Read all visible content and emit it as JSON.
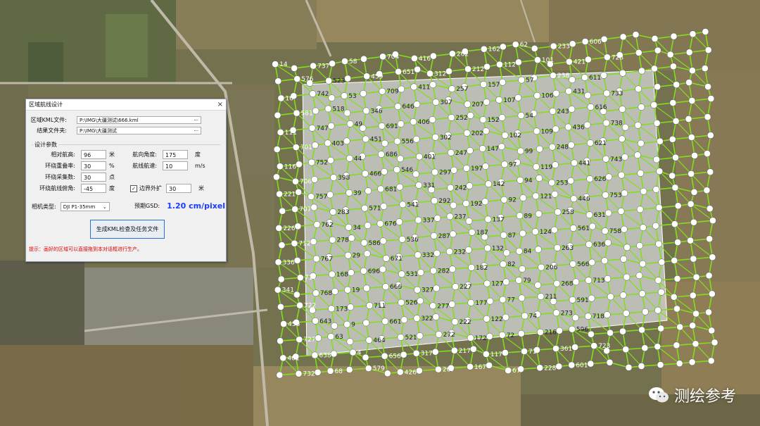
{
  "dialog": {
    "title": "区域航线设计",
    "kml_label": "区域KML文件:",
    "kml_value": "P:\\IMG\\大疆测试\\666.kml",
    "result_label": "结果文件夹:",
    "result_value": "P:\\IMG\\大疆测试",
    "browse": "···",
    "close": "×",
    "params_title": "设计参数",
    "params": {
      "altitude_label": "相对航高:",
      "altitude_value": "96",
      "altitude_unit": "米",
      "heading_label": "航向角度:",
      "heading_value": "175",
      "heading_unit": "度",
      "overlap_label": "环绕重叠率:",
      "overlap_value": "30",
      "overlap_unit": "%",
      "speed_label": "航线航速:",
      "speed_value": "10",
      "speed_unit": "m/s",
      "samples_label": "环绕采集数:",
      "samples_value": "30",
      "samples_unit": "点",
      "pitch_label": "环绕航线俯角:",
      "pitch_value": "-45",
      "pitch_unit": "度",
      "expand_label": "边界外扩",
      "expand_value": "30",
      "expand_unit": "米"
    },
    "camera_label": "相机类型:",
    "camera_value": "DJI P1-35mm",
    "gsd_label": "预期GSD:",
    "gsd_value": "1.20 cm/pixel",
    "generate_button": "生成KML检查及任务文件",
    "tip": "提示：画好的区域可以直接拖到本对话框进行生产。"
  },
  "watermark": "测绘参考",
  "colors": {
    "flight_line": "#7fe01a",
    "waypoint": "#ffffff",
    "gsd": "#1a3cff",
    "tip": "#e00000"
  },
  "map_labels": [
    "14",
    "16",
    "111",
    "116",
    "221",
    "226",
    "336",
    "341",
    "456",
    "461",
    "576",
    "581",
    "701",
    "706",
    "707",
    "712",
    "717",
    "722",
    "727",
    "732",
    "737",
    "742",
    "747",
    "752",
    "757",
    "762",
    "767",
    "768",
    "643",
    "638",
    "523",
    "518",
    "403",
    "398",
    "283",
    "278",
    "168",
    "173",
    "63",
    "68",
    "58",
    "53",
    "49",
    "44",
    "39",
    "34",
    "29",
    "19",
    "9",
    "4",
    "459",
    "346",
    "451",
    "466",
    "571",
    "586",
    "696",
    "711",
    "464",
    "579",
    "704",
    "709",
    "691",
    "686",
    "681",
    "676",
    "671",
    "666",
    "661",
    "656",
    "651",
    "646",
    "556",
    "546",
    "541",
    "536",
    "531",
    "526",
    "521",
    "426",
    "416",
    "411",
    "406",
    "401",
    "331",
    "337",
    "332",
    "327",
    "322",
    "317",
    "312",
    "307",
    "302",
    "297",
    "292",
    "287",
    "282",
    "277",
    "272",
    "267",
    "262",
    "257",
    "252",
    "247",
    "242",
    "237",
    "232",
    "227",
    "222",
    "217",
    "212",
    "207",
    "202",
    "197",
    "192",
    "187",
    "182",
    "177",
    "172",
    "167",
    "162",
    "157",
    "152",
    "147",
    "142",
    "137",
    "132",
    "127",
    "122",
    "117",
    "112",
    "107",
    "102",
    "97",
    "92",
    "87",
    "82",
    "77",
    "72",
    "67",
    "62",
    "57",
    "54",
    "99",
    "94",
    "89",
    "84",
    "79",
    "74",
    "71",
    "101",
    "106",
    "109",
    "119",
    "121",
    "124",
    "206",
    "211",
    "216",
    "228",
    "233",
    "238",
    "243",
    "248",
    "253",
    "258",
    "263",
    "268",
    "273",
    "361",
    "421",
    "431",
    "436",
    "441",
    "446",
    "561",
    "566",
    "591",
    "596",
    "601",
    "606",
    "611",
    "616",
    "621",
    "626",
    "631",
    "636",
    "713",
    "718",
    "723",
    "728",
    "733",
    "738",
    "743",
    "753",
    "758"
  ]
}
